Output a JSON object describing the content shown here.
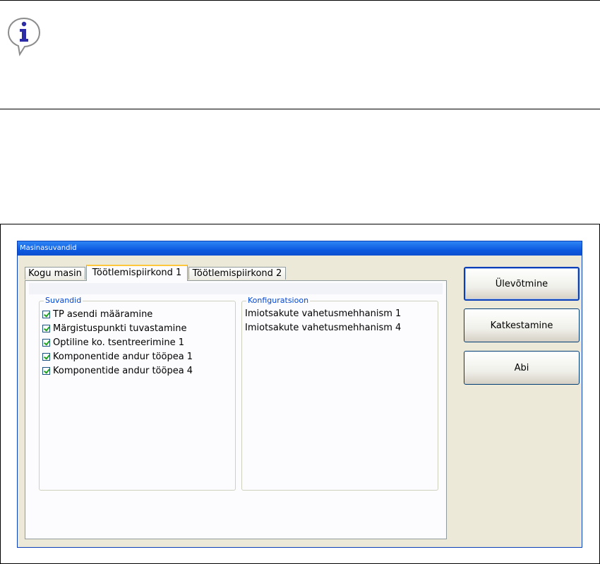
{
  "dialog": {
    "title": "Masinasuvandid",
    "tabs": [
      {
        "label": "Kogu masin",
        "active": false
      },
      {
        "label": "Töötlemispiirkond 1",
        "active": true
      },
      {
        "label": "Töötlemispiirkond 2",
        "active": false
      }
    ],
    "options_group": {
      "legend": "Suvandid",
      "items": [
        {
          "label": "TP asendi määramine",
          "checked": true
        },
        {
          "label": "Märgistuspunkti tuvastamine",
          "checked": true
        },
        {
          "label": "Optiline ko. tsentreerimine 1",
          "checked": true
        },
        {
          "label": "Komponentide andur tööpea 1",
          "checked": true
        },
        {
          "label": "Komponentide andur tööpea 4",
          "checked": true
        }
      ]
    },
    "config_group": {
      "legend": "Konfiguratsioon",
      "items": [
        "Imiotsakute vahetusmehhanism 1",
        "Imiotsakute vahetusmehhanism 4"
      ]
    },
    "buttons": {
      "apply": "Ülevõtmine",
      "cancel": "Katkestamine",
      "help": "Abi"
    }
  },
  "icons": {
    "info": "info-speech-bubble-icon"
  },
  "colors": {
    "titlebar": "#0d5ae0",
    "group_legend": "#0046d5",
    "checkmark": "#21a121",
    "active_tab_accent": "#ffc83c"
  }
}
